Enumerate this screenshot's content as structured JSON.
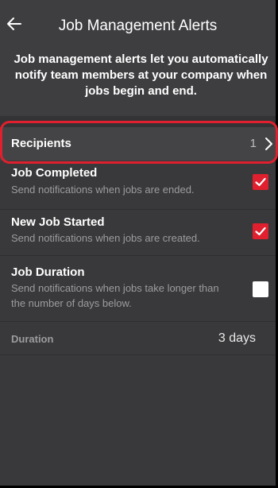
{
  "header": {
    "title": "Job Management Alerts",
    "back_icon": "arrow-left-icon"
  },
  "intro_text": "Job management alerts let you automatically notify team members at your company when jobs begin and end.",
  "recipients": {
    "label": "Recipients",
    "count": "1",
    "icon": "chevron-right-icon"
  },
  "settings": [
    {
      "title": "Job Completed",
      "description": "Send notifications when jobs are ended.",
      "checked": true
    },
    {
      "title": "New Job Started",
      "description": "Send notifications when jobs are created.",
      "checked": true
    },
    {
      "title": "Job Duration",
      "description": "Send notifications when jobs take longer than the number of days below.",
      "checked": false
    }
  ],
  "duration": {
    "label": "Duration",
    "value": "3 days"
  },
  "colors": {
    "accent": "#e0202e",
    "background": "#39393b",
    "header": "#3e3e41",
    "recipients_row": "#444446"
  }
}
